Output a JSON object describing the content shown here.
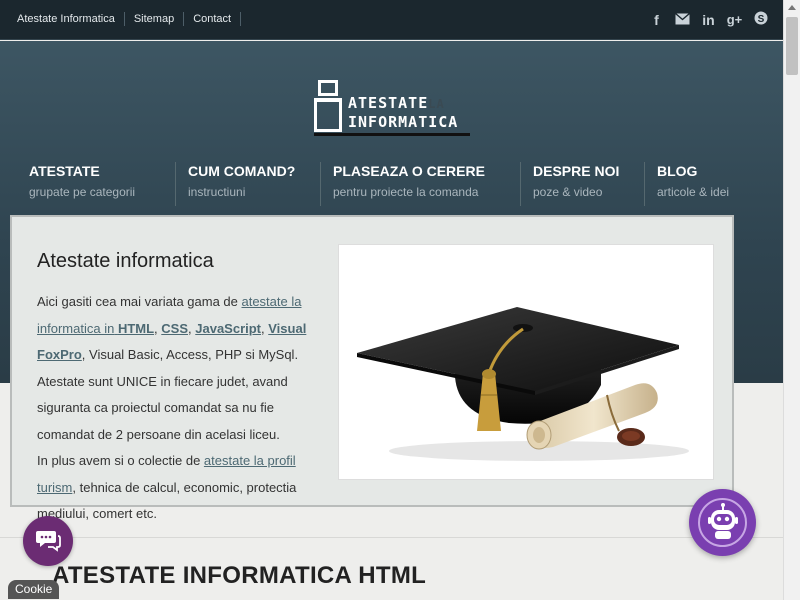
{
  "topbar": {
    "links": [
      "Atestate Informatica",
      "Sitemap",
      "Contact"
    ],
    "social_icons": [
      "facebook-icon",
      "mail-icon",
      "linkedin-icon",
      "google-plus-icon",
      "skype-icon"
    ]
  },
  "logo": {
    "line1": "ATESTATE",
    "line1_small": "LA",
    "line2": "INFORMATICA"
  },
  "nav": [
    {
      "title": "ATESTATE",
      "sub": "grupate pe categorii"
    },
    {
      "title": "CUM COMAND?",
      "sub": "instructiuni"
    },
    {
      "title": "PLASEAZA O CERERE",
      "sub": "pentru proiecte la comanda"
    },
    {
      "title": "DESPRE NOI",
      "sub": "poze & video"
    },
    {
      "title": "BLOG",
      "sub": "articole & idei"
    }
  ],
  "card": {
    "title": "Atestate informatica",
    "p1_start": "Aici gasiti cea mai variata gama de ",
    "p1_link1": "atestate la informatica in",
    "p1_hl1": "HTML",
    "p1_sep1": ", ",
    "p1_hl2": "CSS",
    "p1_sep2": ", ",
    "p1_hl3": "JavaScript",
    "p1_sep3": ", ",
    "p1_hl4": "Visual FoxPro",
    "p1_rest": ", Visual Basic, Access, PHP si MySql.",
    "p2": "Atestate sunt UNICE in fiecare judet, avand siguranta ca proiectul comandat sa nu fie comandat de 2 persoane din acelasi liceu.",
    "p3_start": "In plus avem si o colectie de ",
    "p3_link": "atestate la profil turism",
    "p3_rest": ", tehnica de calcul, economic, protectia mediului, comert etc."
  },
  "section": {
    "title": "ATESTATE INFORMATICA HTML"
  },
  "widgets": {
    "cookie_label": "Cookie",
    "chat_icon": "chat-icon",
    "bot_icon": "robot-icon"
  },
  "colors": {
    "topbar": "#1b272e",
    "hero": "#2f4450",
    "link": "#4d6973",
    "chat": "#6b2c73",
    "bot": "#7a3fb0"
  }
}
